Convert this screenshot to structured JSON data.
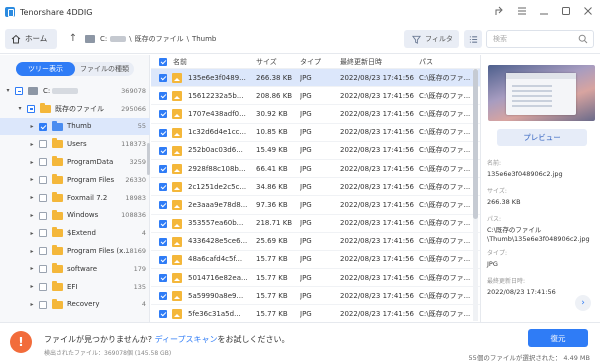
{
  "app": {
    "title": "Tenorshare 4DDIG"
  },
  "toolbar": {
    "home_label": "ホーム",
    "breadcrumb": [
      "C:",
      "既存のファイル",
      "Thumb"
    ],
    "filter_label": "フィルタ",
    "search_placeholder": "検索"
  },
  "sidebar": {
    "tabs": [
      {
        "label": "ツリー表示",
        "active": true
      },
      {
        "label": "ファイルの種類",
        "active": false
      }
    ],
    "tree": [
      {
        "label": "C:",
        "count": "369078",
        "level": 0,
        "expanded": true,
        "check": "partial",
        "icon": "drive-icon"
      },
      {
        "label": "既存のファイル",
        "count": "295066",
        "level": 1,
        "expanded": true,
        "check": "partial",
        "icon": "folder-icon"
      },
      {
        "label": "Thumb",
        "count": "55",
        "level": 2,
        "expanded": false,
        "check": "checked",
        "icon": "folder-icon",
        "selected": true
      },
      {
        "label": "Users",
        "count": "118373",
        "level": 2,
        "expanded": false,
        "check": "none",
        "icon": "folder-icon"
      },
      {
        "label": "ProgramData",
        "count": "3259",
        "level": 2,
        "expanded": false,
        "check": "none",
        "icon": "folder-icon"
      },
      {
        "label": "Program Files",
        "count": "26330",
        "level": 2,
        "expanded": false,
        "check": "none",
        "icon": "folder-icon"
      },
      {
        "label": "Foxmail 7.2",
        "count": "18983",
        "level": 2,
        "expanded": false,
        "check": "none",
        "icon": "folder-icon"
      },
      {
        "label": "Windows",
        "count": "108836",
        "level": 2,
        "expanded": false,
        "check": "none",
        "icon": "folder-icon"
      },
      {
        "label": "$Extend",
        "count": "4",
        "level": 2,
        "expanded": false,
        "check": "none",
        "icon": "folder-icon"
      },
      {
        "label": "Program Files (x...",
        "count": "18169",
        "level": 2,
        "expanded": false,
        "check": "none",
        "icon": "folder-icon"
      },
      {
        "label": "software",
        "count": "179",
        "level": 2,
        "expanded": false,
        "check": "none",
        "icon": "folder-icon"
      },
      {
        "label": "EFI",
        "count": "135",
        "level": 2,
        "expanded": false,
        "check": "none",
        "icon": "folder-icon"
      },
      {
        "label": "Recovery",
        "count": "4",
        "level": 2,
        "expanded": false,
        "check": "none",
        "icon": "folder-icon"
      }
    ]
  },
  "file_list": {
    "columns": [
      "名前",
      "サイズ",
      "タイプ",
      "最終更新日時",
      "パス"
    ],
    "rows": [
      {
        "name": "135e6e3f0489...",
        "size": "266.38 KB",
        "type": "JPG",
        "date": "2022/08/23 17:41:56",
        "path": "C:\\既存のファ...",
        "selected": true
      },
      {
        "name": "15612232a5b...",
        "size": "208.86 KB",
        "type": "JPG",
        "date": "2022/08/23 17:41:56",
        "path": "C:\\既存のファ..."
      },
      {
        "name": "1707e438adf0...",
        "size": "30.92 KB",
        "type": "JPG",
        "date": "2022/08/23 17:41:56",
        "path": "C:\\既存のファ..."
      },
      {
        "name": "1c32d6d4e1cc...",
        "size": "10.85 KB",
        "type": "JPG",
        "date": "2022/08/23 17:41:56",
        "path": "C:\\既存のファ..."
      },
      {
        "name": "252b0ac03d6...",
        "size": "15.49 KB",
        "type": "JPG",
        "date": "2022/08/23 17:41:56",
        "path": "C:\\既存のファ..."
      },
      {
        "name": "2928f88c108b...",
        "size": "66.41 KB",
        "type": "JPG",
        "date": "2022/08/23 17:41:56",
        "path": "C:\\既存のファ..."
      },
      {
        "name": "2c1251de2c5c...",
        "size": "34.86 KB",
        "type": "JPG",
        "date": "2022/08/23 17:41:56",
        "path": "C:\\既存のファ..."
      },
      {
        "name": "2e3aaa9e78d8...",
        "size": "97.36 KB",
        "type": "JPG",
        "date": "2022/08/23 17:41:56",
        "path": "C:\\既存のファ..."
      },
      {
        "name": "353557ea60b...",
        "size": "218.71 KB",
        "type": "JPG",
        "date": "2022/08/23 17:41:56",
        "path": "C:\\既存のファ..."
      },
      {
        "name": "4336428e5ce6...",
        "size": "25.69 KB",
        "type": "JPG",
        "date": "2022/08/23 17:41:56",
        "path": "C:\\既存のファ..."
      },
      {
        "name": "48a6cafd4c5f...",
        "size": "15.77 KB",
        "type": "JPG",
        "date": "2022/08/23 17:41:56",
        "path": "C:\\既存のファ..."
      },
      {
        "name": "5014716e82ea...",
        "size": "15.77 KB",
        "type": "JPG",
        "date": "2022/08/23 17:41:56",
        "path": "C:\\既存のファ..."
      },
      {
        "name": "5a59990a8e9...",
        "size": "15.77 KB",
        "type": "JPG",
        "date": "2022/08/23 17:41:56",
        "path": "C:\\既存のファ..."
      },
      {
        "name": "5fe36c31a5d...",
        "size": "15.77 KB",
        "type": "JPG",
        "date": "2022/08/23 17:41:56",
        "path": "C:\\既存のファ..."
      }
    ]
  },
  "preview": {
    "button_label": "プレビュー",
    "name_label": "名前:",
    "name_value": "135e6e3f048906c2.jpg",
    "size_label": "サイズ:",
    "size_value": "266.38 KB",
    "path_label": "パス:",
    "path_value": "C:\\既存のファイル\\Thumb\\135e6e3f048906c2.jpg",
    "type_label": "タイプ:",
    "type_value": "JPG",
    "date_label": "最終更新日時:",
    "date_value": "2022/08/23 17:41:56"
  },
  "bottom": {
    "message_prefix": "ファイルが見つかりませんか?",
    "message_link": "ディープスキャン",
    "message_suffix": "をお試しください。",
    "sub_text": "検出されたファイル：369078個 (145.58 GB)",
    "recover_label": "復元",
    "status_text": "55個のファイルが選択された：  4.49 MB"
  },
  "colors": {
    "accent": "#2f7cf6",
    "selection": "#dce7fb",
    "folder": "#f4b73a",
    "warning": "#f26c3b"
  }
}
